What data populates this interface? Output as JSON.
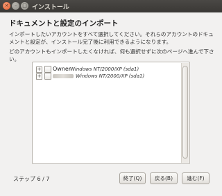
{
  "window": {
    "title": "インストール",
    "close_glyph": "×",
    "min_glyph": "–",
    "max_glyph": "□"
  },
  "page": {
    "heading": "ドキュメントと設定のインポート",
    "description": "インポートしたいアカウントをすべて選択してください。それらのアカウントのドキュメントと設定が、インストール完了後に利用できるようになります。",
    "skip_note": "どのアカウントもインポートしたくなければ、何も選択せずに次のページへ進んで下さい。"
  },
  "accounts": [
    {
      "name": "Owner",
      "os": "Windows NT/2000/XP (sda1)",
      "expander": "+"
    },
    {
      "name": "",
      "os": "Windows NT/2000/XP (sda1)",
      "expander": "+"
    }
  ],
  "footer": {
    "step": "ステップ 6 / 7",
    "quit_label": "終了(Q)",
    "back_label": "戻る(B)",
    "forward_label": "進む(F)"
  }
}
